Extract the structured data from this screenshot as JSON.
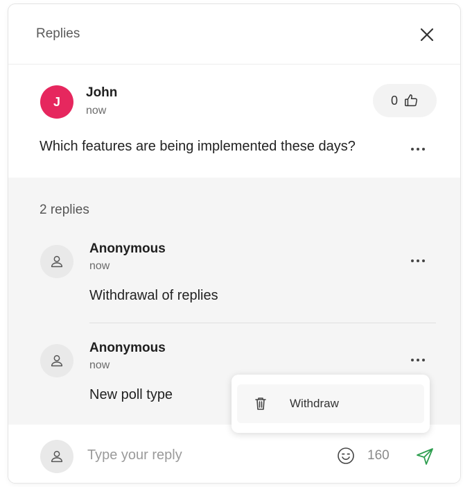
{
  "header": {
    "title": "Replies"
  },
  "question": {
    "avatar_initial": "J",
    "avatar_color": "#e6275e",
    "author": "John",
    "time": "now",
    "likes": "0",
    "text": "Which features are being implemented these days?"
  },
  "replies_section": {
    "count_label": "2 replies",
    "items": [
      {
        "author": "Anonymous",
        "time": "now",
        "text": "Withdrawal of replies"
      },
      {
        "author": "Anonymous",
        "time": "now",
        "text": "New poll type"
      }
    ]
  },
  "context_menu": {
    "withdraw_label": "Withdraw"
  },
  "composer": {
    "placeholder": "Type your reply",
    "char_count": "160"
  },
  "colors": {
    "send_accent": "#2e9e4f"
  }
}
